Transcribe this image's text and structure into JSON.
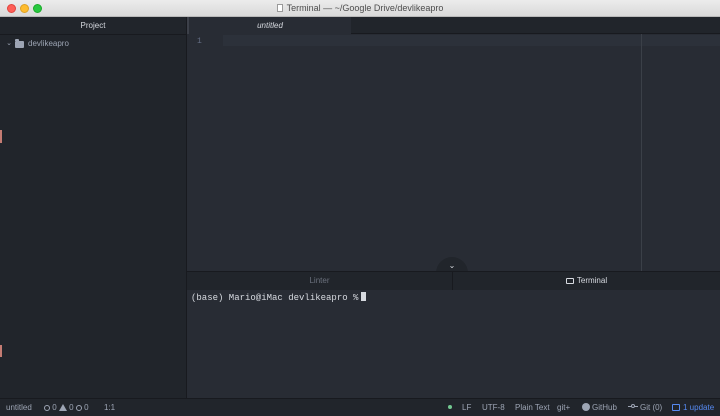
{
  "window": {
    "title": "Terminal — ~/Google Drive/devlikeapro"
  },
  "sidebar": {
    "header": "Project",
    "root_folder": "devlikeapro"
  },
  "tabs": [
    {
      "label": "untitled",
      "active": true
    }
  ],
  "editor": {
    "line_numbers": [
      "1"
    ]
  },
  "bottom_panel": {
    "tabs": [
      "Linter",
      "Terminal"
    ],
    "active_tab": "Terminal",
    "terminal_prompt": "(base) Mario@iMac devlikeapro %"
  },
  "status_bar": {
    "file_name": "untitled",
    "errors": "0",
    "warnings": "0",
    "infos": "0",
    "cursor_position": "1:1",
    "line_ending": "LF",
    "encoding": "UTF-8",
    "grammar": "Plain Text",
    "git_plus": "git+",
    "github": "GitHub",
    "git": "Git (0)",
    "updates": "1 update"
  },
  "colors": {
    "accent_blue": "#568af2",
    "status_green": "#73c991"
  }
}
